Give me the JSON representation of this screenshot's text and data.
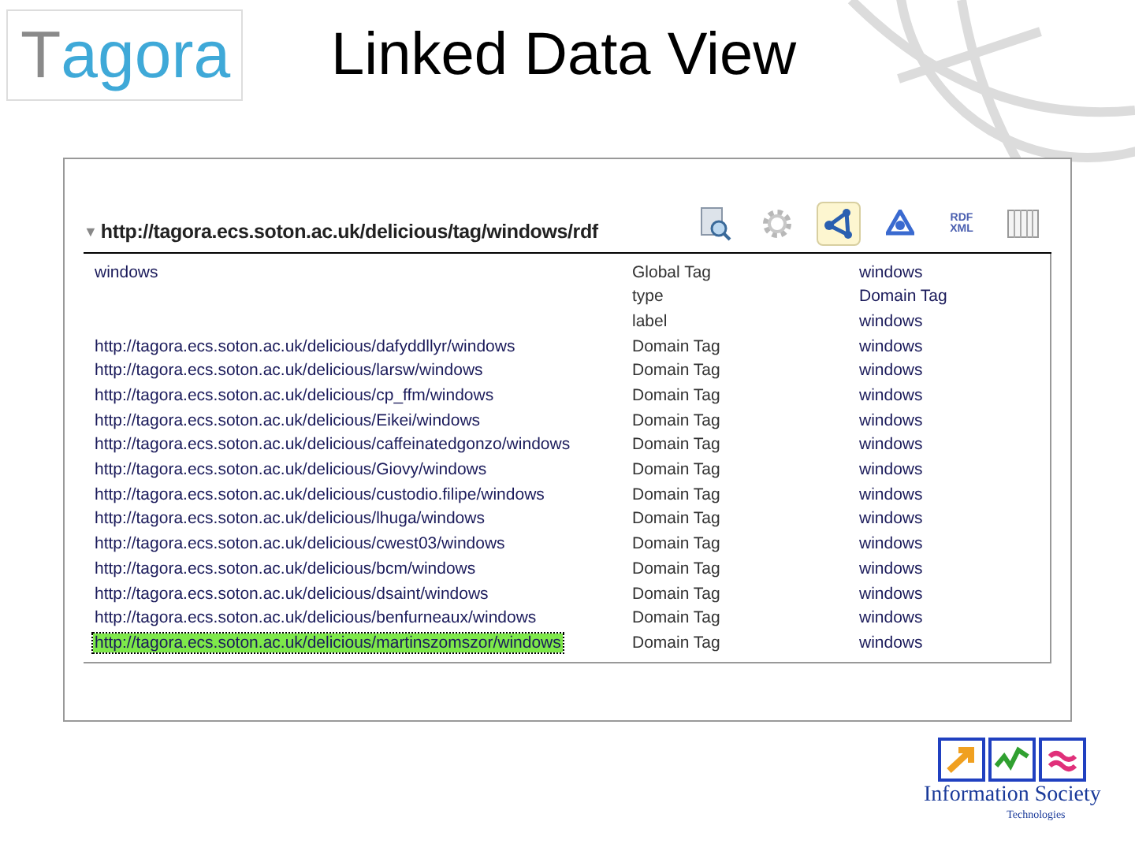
{
  "logo": {
    "first_letter": "T",
    "rest": "agora"
  },
  "slide_title": "Linked Data View",
  "resource": {
    "toggle": "▼",
    "uri": "http://tagora.ecs.soton.ac.uk/delicious/tag/windows/rdf"
  },
  "toolbar": [
    {
      "kind": "search",
      "selected": false
    },
    {
      "kind": "settings",
      "selected": false
    },
    {
      "kind": "graph",
      "selected": true
    },
    {
      "kind": "network",
      "selected": false
    },
    {
      "kind": "rdf",
      "label_top": "RDF",
      "label_bottom": "XML",
      "selected": false
    },
    {
      "kind": "table",
      "selected": false
    }
  ],
  "table": {
    "rows": [
      {
        "column_1": "windows",
        "column_2": "Global Tag",
        "column_3": "windows",
        "selected": false
      },
      {
        "column_2": "type",
        "column_3": "Domain Tag",
        "selected": false
      },
      {
        "column_2": "label",
        "column_3": "windows",
        "selected": false
      },
      {
        "column_1": "http://tagora.ecs.soton.ac.uk/delicious/dafyddllyr/windows",
        "column_2": "Domain Tag",
        "column_3": "windows",
        "selected": false
      },
      {
        "column_1": "http://tagora.ecs.soton.ac.uk/delicious/larsw/windows",
        "column_2": "Domain Tag",
        "column_3": "windows",
        "selected": false
      },
      {
        "column_1": "http://tagora.ecs.soton.ac.uk/delicious/cp_ffm/windows",
        "column_2": "Domain Tag",
        "column_3": "windows",
        "selected": false
      },
      {
        "column_1": "http://tagora.ecs.soton.ac.uk/delicious/Eikei/windows",
        "column_2": "Domain Tag",
        "column_3": "windows",
        "selected": false
      },
      {
        "column_1": "http://tagora.ecs.soton.ac.uk/delicious/caffeinatedgonzo/windows",
        "column_2": "Domain Tag",
        "column_3": "windows",
        "selected": false
      },
      {
        "column_1": "http://tagora.ecs.soton.ac.uk/delicious/Giovy/windows",
        "column_2": "Domain Tag",
        "column_3": "windows",
        "selected": false
      },
      {
        "column_1": "http://tagora.ecs.soton.ac.uk/delicious/custodio.filipe/windows",
        "column_2": "Domain Tag",
        "column_3": "windows",
        "selected": false
      },
      {
        "column_1": "http://tagora.ecs.soton.ac.uk/delicious/lhuga/windows",
        "column_2": "Domain Tag",
        "column_3": "windows",
        "selected": false
      },
      {
        "column_1": "http://tagora.ecs.soton.ac.uk/delicious/cwest03/windows",
        "column_2": "Domain Tag",
        "column_3": "windows",
        "selected": false
      },
      {
        "column_1": "http://tagora.ecs.soton.ac.uk/delicious/bcm/windows",
        "column_2": "Domain Tag",
        "column_3": "windows",
        "selected": false
      },
      {
        "column_1": "http://tagora.ecs.soton.ac.uk/delicious/dsaint/windows",
        "column_2": "Domain Tag",
        "column_3": "windows",
        "selected": false
      },
      {
        "column_1": "http://tagora.ecs.soton.ac.uk/delicious/benfurneaux/windows",
        "column_2": "Domain Tag",
        "column_3": "windows",
        "selected": false
      },
      {
        "column_1": "http://tagora.ecs.soton.ac.uk/delicious/martinszomszor/windows",
        "column_2": "Domain Tag",
        "column_3": "windows",
        "selected": true
      }
    ]
  },
  "footer_logo": {
    "title": "Information Society",
    "subtitle": "Technologies"
  }
}
